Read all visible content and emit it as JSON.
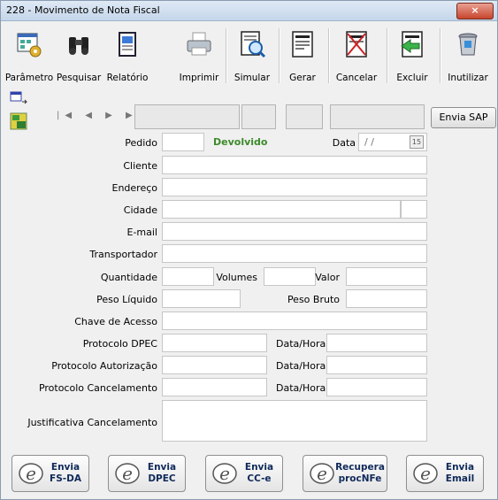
{
  "window": {
    "title": "228 - Movimento de Nota Fiscal",
    "close_label": "×"
  },
  "toolbar": {
    "items": [
      {
        "label": "Parâmetro",
        "icon": "parameters-icon"
      },
      {
        "label": "Pesquisar",
        "icon": "binoculars-icon"
      },
      {
        "label": "Relatório",
        "icon": "report-icon"
      },
      {
        "label": "Imprimir",
        "icon": "printer-icon"
      },
      {
        "label": "Simular",
        "icon": "simulate-document-icon"
      },
      {
        "label": "Gerar",
        "icon": "generate-document-icon"
      },
      {
        "label": "Cancelar",
        "icon": "cancel-document-icon"
      },
      {
        "label": "Excluir",
        "icon": "delete-document-icon"
      },
      {
        "label": "Inutilizar",
        "icon": "trash-icon"
      }
    ]
  },
  "navigator": {
    "glyphs": "|◀ ◀ ▶ ▶|"
  },
  "envia_sap": "Envia SAP",
  "form": {
    "pedido_label": "Pedido",
    "pedido_value": "",
    "status": "Devolvido",
    "data_label": "Data",
    "data_value": "/ /",
    "cliente_label": "Cliente",
    "endereco_label": "Endereço",
    "cidade_label": "Cidade",
    "email_label": "E-mail",
    "transportador_label": "Transportador",
    "quantidade_label": "Quantidade",
    "volumes_label": "Volumes",
    "valor_label": "Valor",
    "peso_liquido_label": "Peso Líquido",
    "peso_bruto_label": "Peso Bruto",
    "chave_label": "Chave de Acesso",
    "protocolo_dpec_label": "Protocolo DPEC",
    "protocolo_aut_label": "Protocolo Autorização",
    "protocolo_canc_label": "Protocolo Cancelamento",
    "datahora_label": "Data/Hora",
    "justificativa_label": "Justificativa Cancelamento"
  },
  "bottom_buttons": [
    {
      "label": "Envia\nFS-DA"
    },
    {
      "label": "Envia\nDPEC"
    },
    {
      "label": "Envia\nCC-e"
    },
    {
      "label": "Recupera\nprocNFe"
    },
    {
      "label": "Envia\nEmail"
    }
  ],
  "colors": {
    "status_green": "#3b8b2a",
    "title_bar": "#c5d6ea",
    "close_red": "#c7452d"
  }
}
